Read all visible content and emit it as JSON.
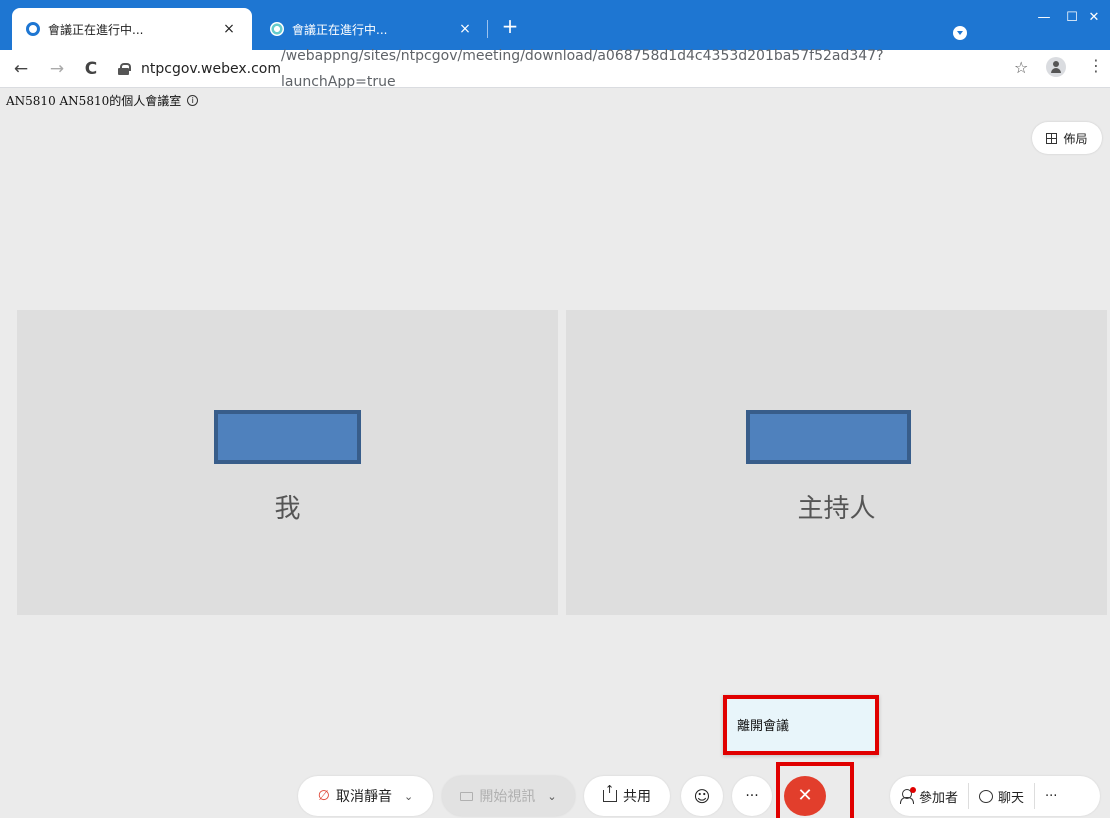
{
  "browser": {
    "tabs": [
      {
        "label": "會議正在進行中..."
      },
      {
        "label": "會議正在進行中..."
      }
    ],
    "tab_close": "×",
    "new_tab": "+",
    "window_controls": {
      "minimize": "—",
      "maximize": "☐",
      "close": "✕"
    },
    "nav": {
      "back": "←",
      "forward": "→",
      "reload": "C"
    },
    "url_host": "ntpcgov.webex.com",
    "url_path": "/webappng/sites/ntpcgov/meeting/download/a068758d1d4c4353d201ba57f52ad347?launchApp=true",
    "bookmark_star": "☆",
    "menu": "⋮"
  },
  "meeting": {
    "room_title": "AN5810 AN5810的個人會議室",
    "info_icon": "i",
    "layout_label": "佈局",
    "participants": [
      {
        "name": "我"
      },
      {
        "name": "主持人"
      }
    ],
    "leave_popup": "離開會議",
    "controls": {
      "mute_label": "取消靜音",
      "mute_icon": "∅",
      "caret": "⌄",
      "video_label": "開始視訊",
      "share_label": "共用",
      "emoji": "☺",
      "more": "···",
      "leave": "✕",
      "participants_label": "參加者",
      "chat_label": "聊天",
      "more_right": "···"
    },
    "colors": {
      "leave_red": "#e23e2c",
      "highlight_red": "#e00000",
      "browser_blue": "#1e76d2"
    }
  }
}
